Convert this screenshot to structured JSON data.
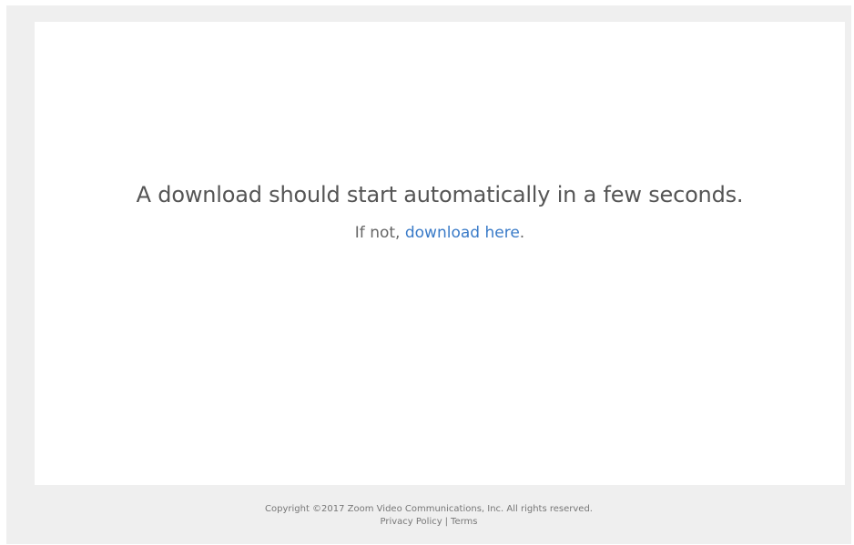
{
  "main": {
    "headline": "A download should start automatically in a few seconds.",
    "subline_prefix": "If not, ",
    "download_link": "download here",
    "subline_suffix": "."
  },
  "footer": {
    "copyright": "Copyright ©2017 Zoom Video Communications, Inc. All rights reserved.",
    "privacy_link": "Privacy Policy",
    "separator": "|",
    "terms_link": "Terms"
  },
  "colors": {
    "page_background": "#efefef",
    "card_background": "#ffffff",
    "link": "#3a7bc8",
    "headline_text": "#555555",
    "footer_text": "#777777"
  }
}
